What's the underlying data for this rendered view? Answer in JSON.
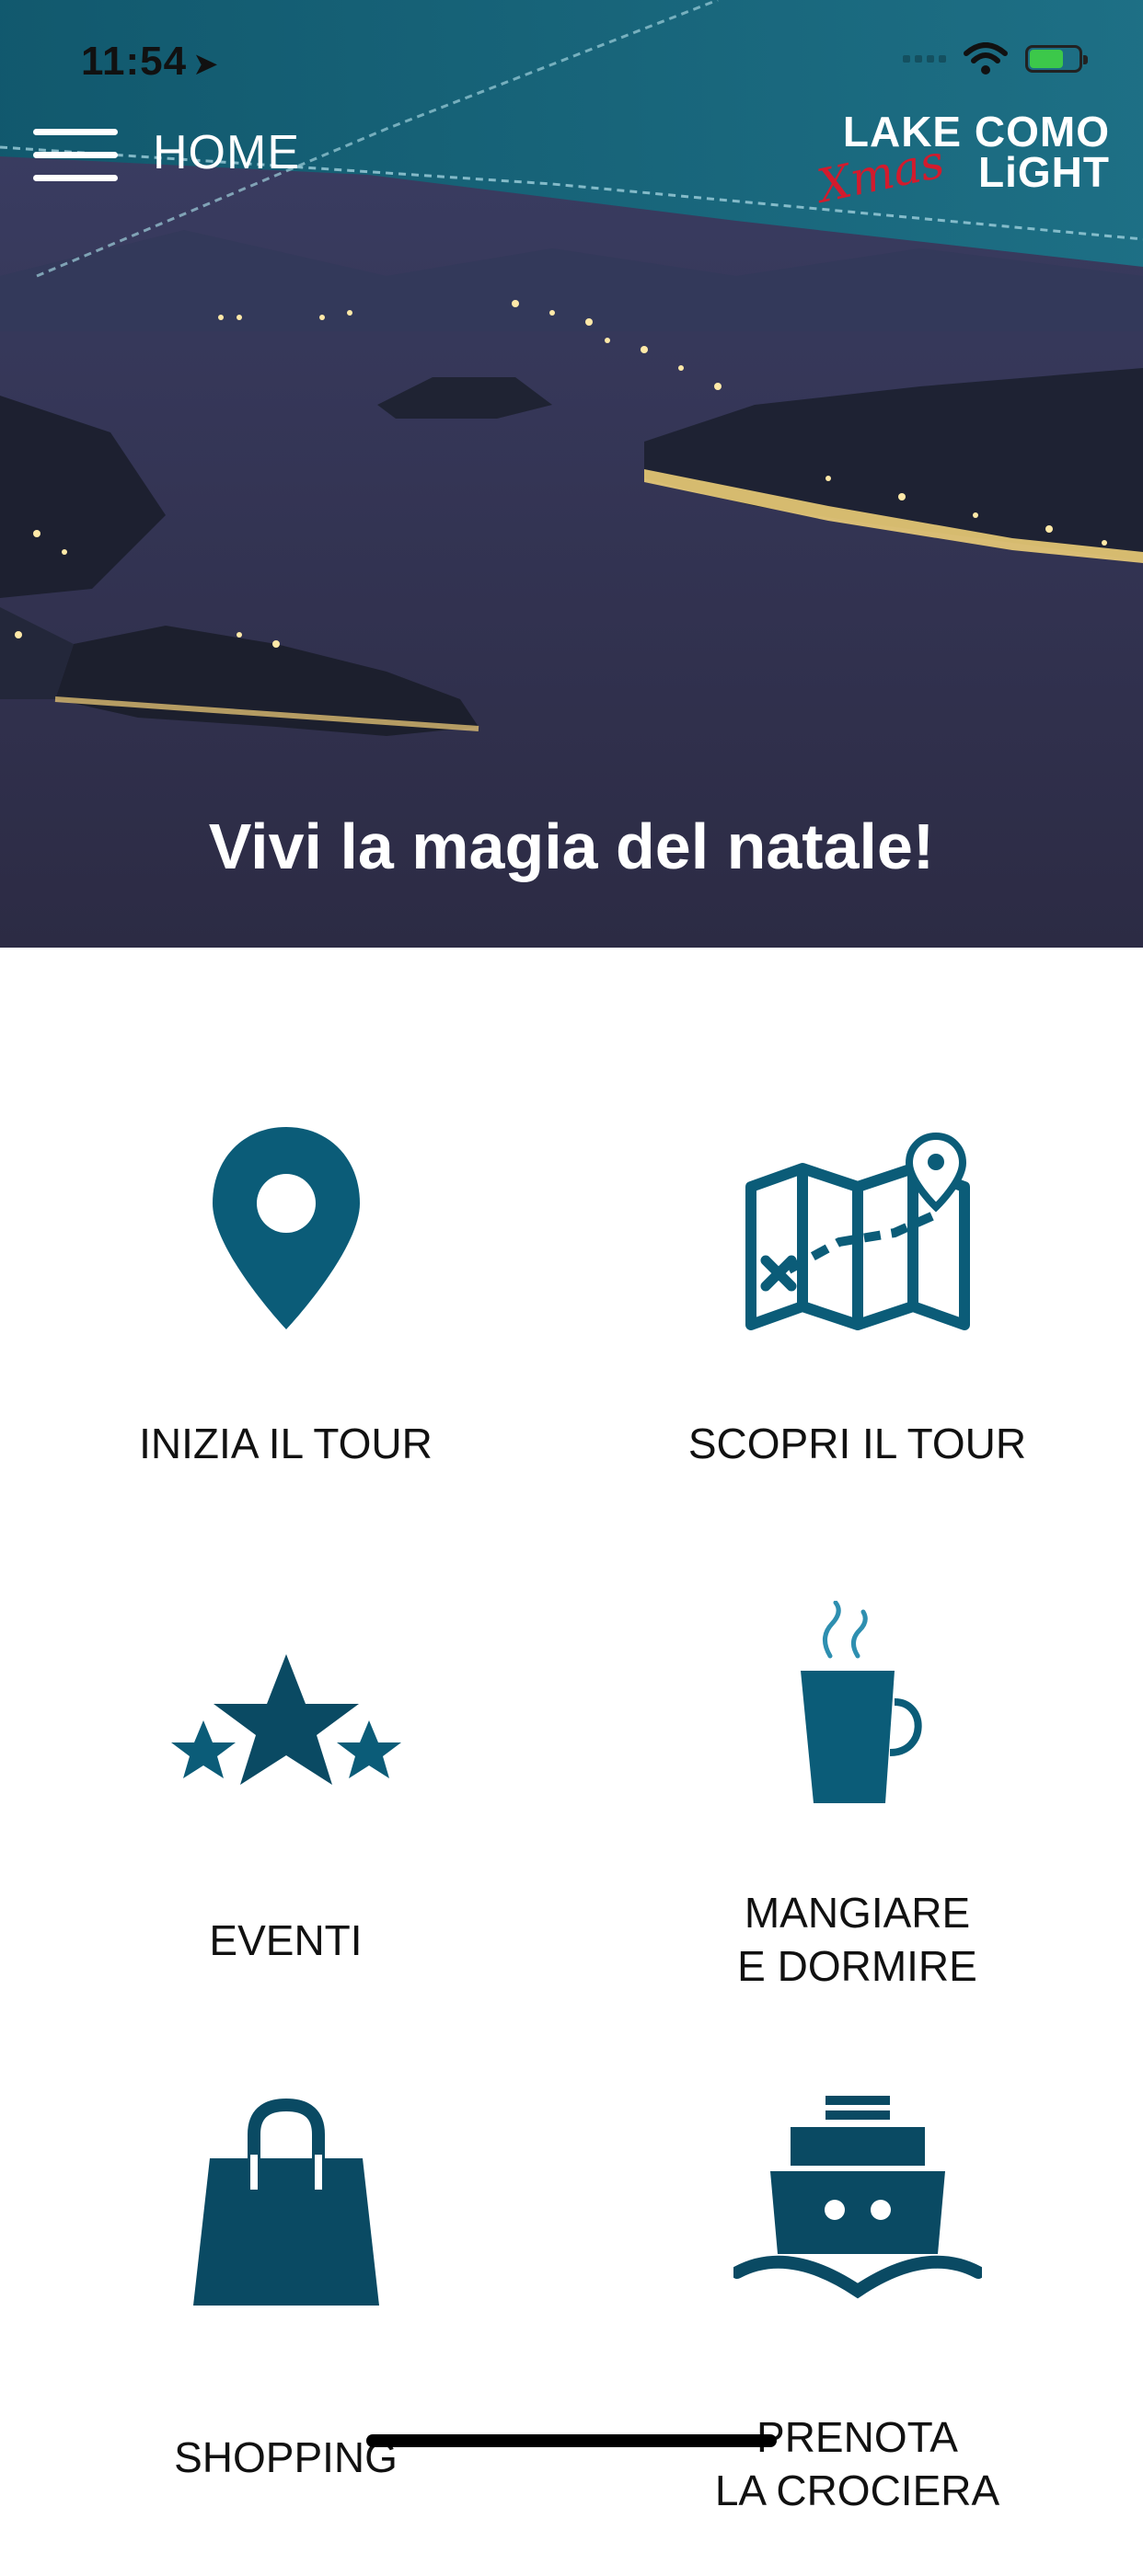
{
  "status_bar": {
    "time": "11:54",
    "location_glyph": "➤"
  },
  "header": {
    "title": "HOME",
    "logo_line1": "LAKE COMO",
    "logo_line2": "LiGHT",
    "logo_script": "Xmas"
  },
  "hero": {
    "tagline": "Vivi la magia del natale!"
  },
  "menu": [
    {
      "label": "INIZIA IL TOUR",
      "icon": "map-pin-icon"
    },
    {
      "label": "SCOPRI IL TOUR",
      "icon": "folded-map-icon"
    },
    {
      "label": "EVENTI",
      "icon": "stars-icon"
    },
    {
      "label": "MANGIARE\nE DORMIRE",
      "icon": "coffee-cup-icon"
    },
    {
      "label": "SHOPPING",
      "icon": "shopping-bag-icon"
    },
    {
      "label": "PRENOTA\nLA CROCIERA",
      "icon": "ship-icon"
    }
  ],
  "colors": {
    "icon_primary": "#0b5c78",
    "icon_dark": "#0a4a63",
    "header_teal": "#1b6b80",
    "xmas_red": "#d21b2d"
  }
}
